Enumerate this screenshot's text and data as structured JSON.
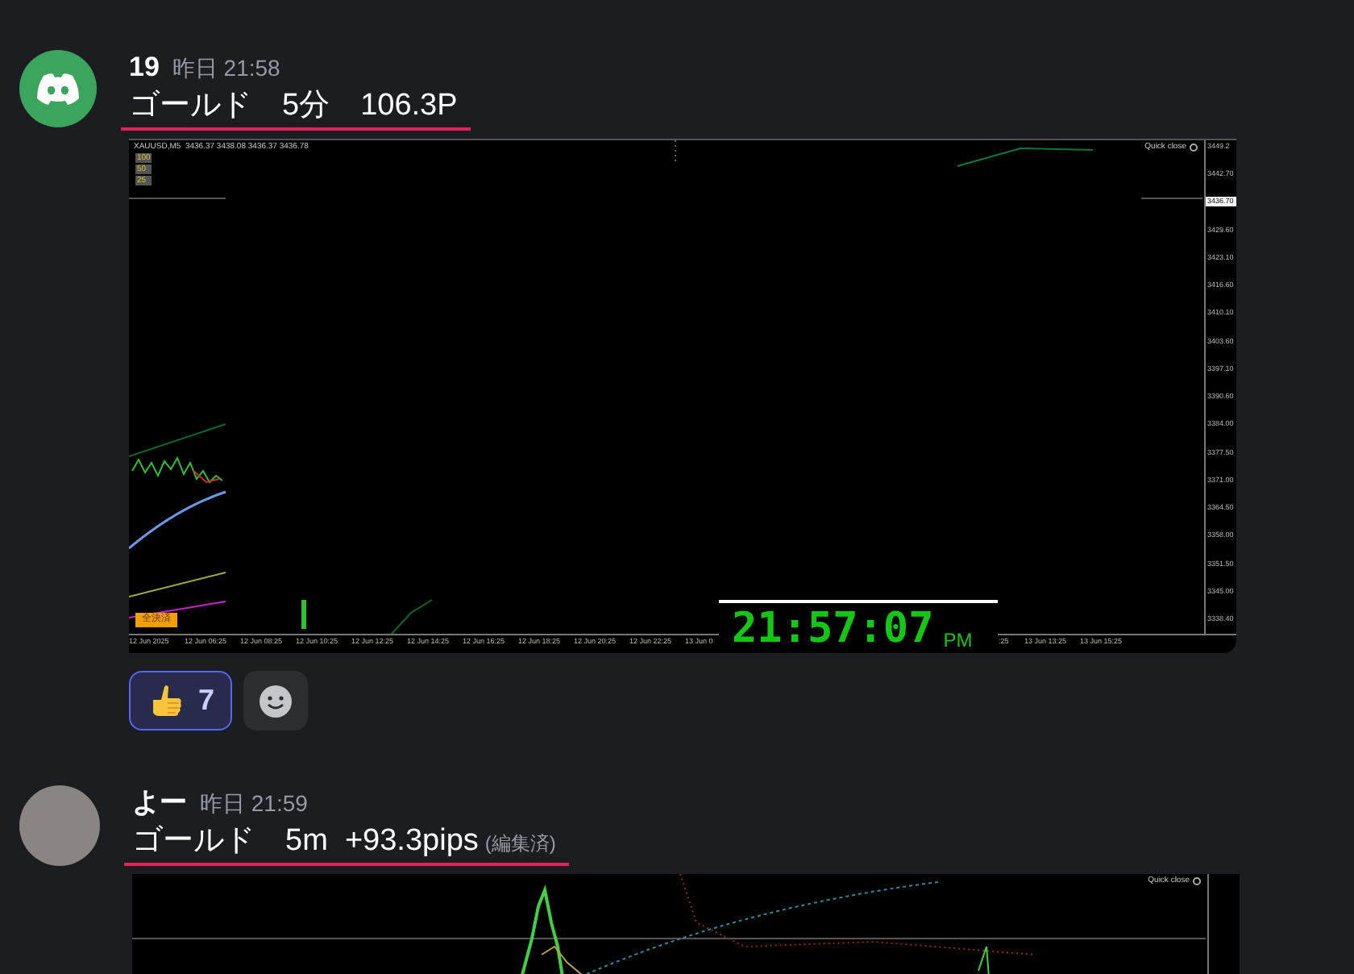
{
  "messages": [
    {
      "author": "19",
      "avatar": {
        "kind": "logo"
      },
      "timestamp": "昨日 21:58",
      "text": "ゴールド　5分　106.3P",
      "chart": {
        "header": "XAUUSD,M5  3436.37 3438.08 3436.37 3436.78",
        "lots": [
          "100",
          "50",
          "25"
        ],
        "close_all": "全決済",
        "quick_close": "Quick close",
        "price_labels": [
          {
            "text": "3449.2",
            "selected": false
          },
          {
            "text": "3442.70",
            "selected": false
          },
          {
            "text": "3436.70",
            "selected": true
          },
          {
            "text": "3429.60",
            "selected": false
          },
          {
            "text": "3423.10",
            "selected": false
          },
          {
            "text": "3416.60",
            "selected": false
          },
          {
            "text": "3410.10",
            "selected": false
          },
          {
            "text": "3403.60",
            "selected": false
          },
          {
            "text": "3397.10",
            "selected": false
          },
          {
            "text": "3390.60",
            "selected": false
          },
          {
            "text": "3384.00",
            "selected": false
          },
          {
            "text": "3377.50",
            "selected": false
          },
          {
            "text": "3371.00",
            "selected": false
          },
          {
            "text": "3364.50",
            "selected": false
          },
          {
            "text": "3358.00",
            "selected": false
          },
          {
            "text": "3351.50",
            "selected": false
          },
          {
            "text": "3345.00",
            "selected": false
          },
          {
            "text": "3338.40",
            "selected": false
          }
        ],
        "time_labels_left": [
          "12 Jun 2025",
          "12 Jun 06:25",
          "12 Jun 08:25",
          "12 Jun 10:25",
          "12 Jun 12:25",
          "12 Jun 14:25",
          "12 Jun 16:25",
          "12 Jun 18:25",
          "12 Jun 20:25",
          "12 Jun 22:25",
          "13 Jun 0"
        ],
        "time_labels_right": [
          ":25",
          "13 Jun 13:25",
          "13 Jun 15:25"
        ],
        "clock": {
          "time": "21:57:07",
          "period": "PM"
        }
      },
      "reactions": [
        {
          "count": "7",
          "selected": true
        }
      ]
    },
    {
      "author": "よー",
      "avatar": {
        "kind": "photo"
      },
      "timestamp": "昨日 21:59",
      "text": "ゴールド　5m  +93.3pips",
      "edited": "(編集済)",
      "chart": {
        "quick_close": "Quick close"
      }
    }
  ]
}
